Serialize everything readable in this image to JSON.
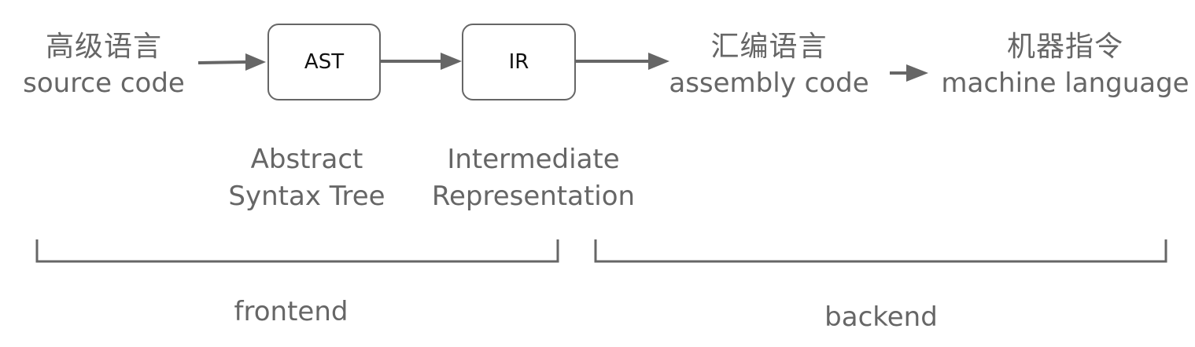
{
  "stages": {
    "source": {
      "zh": "高级语言",
      "en": "source code"
    },
    "ast": {
      "box": "AST",
      "line1": "Abstract",
      "line2": "Syntax Tree"
    },
    "ir": {
      "box": "IR",
      "line1": "Intermediate",
      "line2": "Representation"
    },
    "assembly": {
      "zh": "汇编语言",
      "en": "assembly code"
    },
    "machine": {
      "zh": "机器指令",
      "en": "machine language"
    }
  },
  "groups": {
    "frontend": "frontend",
    "backend": "backend"
  },
  "colors": {
    "line": "#666666",
    "text": "#666666",
    "box_text": "#111111"
  }
}
